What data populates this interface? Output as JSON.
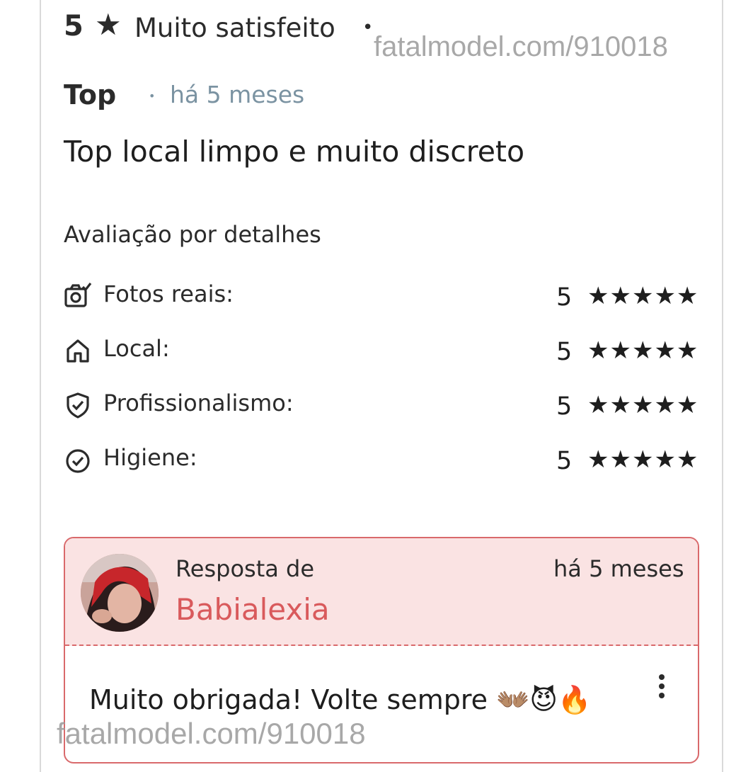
{
  "review": {
    "rating": "5",
    "rating_star_icon": "star-icon",
    "rating_label": "Muito satisfeito",
    "separator": "•",
    "title": "Top",
    "time_separator": "•",
    "time": "há 5 meses",
    "text": "Top local limpo e muito discreto"
  },
  "watermark": {
    "top": "fatalmodel.com/910018",
    "bottom": "fatalmodel.com/910018"
  },
  "details": {
    "title": "Avaliação por detalhes",
    "items": [
      {
        "icon": "camera-check-icon",
        "label": "Fotos reais:",
        "score": "5",
        "stars": "★★★★★"
      },
      {
        "icon": "house-icon",
        "label": "Local:",
        "score": "5",
        "stars": "★★★★★"
      },
      {
        "icon": "shield-check-icon",
        "label": "Profissionalismo:",
        "score": "5",
        "stars": "★★★★★"
      },
      {
        "icon": "circle-check-icon",
        "label": "Higiene:",
        "score": "5",
        "stars": "★★★★★"
      }
    ]
  },
  "reply": {
    "from_label": "Resposta de",
    "author": "Babialexia",
    "time": "há 5 meses",
    "text": "Muito obrigada! Volte sempre 👐🏽😈🔥",
    "menu_icon": "more-vertical-icon",
    "colors": {
      "accent": "#d95a5c",
      "header_bg": "#fae3e3",
      "border": "#d9696b"
    }
  }
}
